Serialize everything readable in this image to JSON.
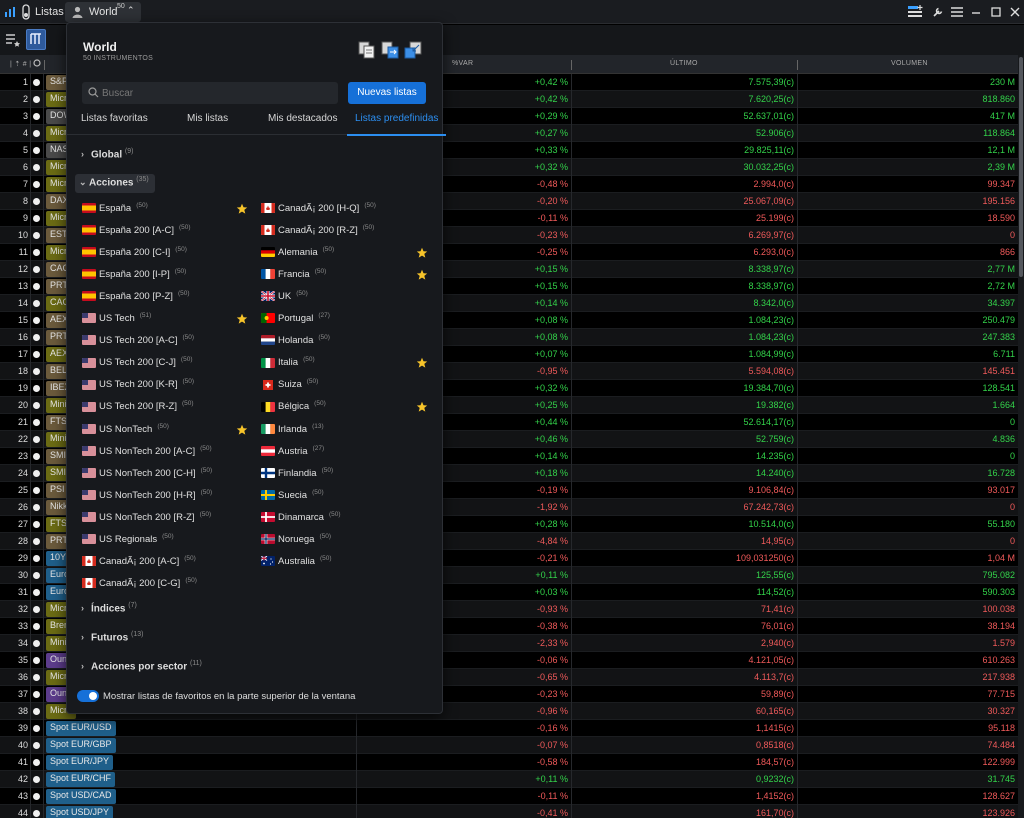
{
  "titlebar": {
    "app_label": "Listas",
    "watchlist_label": "World",
    "watchlist_count": "50"
  },
  "columns": {
    "var": "%VAR",
    "last": "ÚLTIMO",
    "volume": "VOLUMEN"
  },
  "rows": [
    {
      "n": "1",
      "sym": "S&P",
      "color": "#6b5a3c",
      "var": "+0,42 %",
      "last": "7.575,39(c)",
      "vol": "230 M",
      "dir": "pos"
    },
    {
      "n": "2",
      "sym": "Micro",
      "color": "#6b6b14",
      "var": "+0,42 %",
      "last": "7.620,25(c)",
      "vol": "818.860",
      "dir": "pos"
    },
    {
      "n": "3",
      "sym": "DOW",
      "color": "#4a4a4a",
      "var": "+0,29 %",
      "last": "52.637,01(c)",
      "vol": "417 M",
      "dir": "pos"
    },
    {
      "n": "4",
      "sym": "Micro",
      "color": "#6b6b14",
      "var": "+0,27 %",
      "last": "52.906(c)",
      "vol": "118.864",
      "dir": "pos"
    },
    {
      "n": "5",
      "sym": "NASDAQ",
      "color": "#4a4a4a",
      "var": "+0,33 %",
      "last": "29.825,11(c)",
      "vol": "12,1 M",
      "dir": "pos"
    },
    {
      "n": "6",
      "sym": "Micro",
      "color": "#6b6b14",
      "var": "+0,32 %",
      "last": "30.032,25(c)",
      "vol": "2,39 M",
      "dir": "pos"
    },
    {
      "n": "7",
      "sym": "Micro",
      "color": "#6b6b14",
      "var": "-0,48 %",
      "last": "2.994,0(c)",
      "vol": "99.347",
      "dir": "neg"
    },
    {
      "n": "8",
      "sym": "DAX",
      "color": "#6b5a3c",
      "var": "-0,20 %",
      "last": "25.067,09(c)",
      "vol": "195.156",
      "dir": "neg"
    },
    {
      "n": "9",
      "sym": "Micro",
      "color": "#6b6b14",
      "var": "-0,11 %",
      "last": "25.199(c)",
      "vol": "18.590",
      "dir": "neg"
    },
    {
      "n": "10",
      "sym": "ESTX",
      "color": "#6b5a3c",
      "var": "-0,23 %",
      "last": "6.269,97(c)",
      "vol": "0",
      "dir": "neg"
    },
    {
      "n": "11",
      "sym": "Micro",
      "color": "#6b6b14",
      "var": "-0,25 %",
      "last": "6.293,0(c)",
      "vol": "866",
      "dir": "neg"
    },
    {
      "n": "12",
      "sym": "CAC",
      "color": "#6b5a3c",
      "var": "+0,15 %",
      "last": "8.338,97(c)",
      "vol": "2,77 M",
      "dir": "pos"
    },
    {
      "n": "13",
      "sym": "PRT",
      "color": "#6b5a3c",
      "var": "+0,15 %",
      "last": "8.338,97(c)",
      "vol": "2,72 M",
      "dir": "pos"
    },
    {
      "n": "14",
      "sym": "CAC",
      "color": "#6b6b14",
      "var": "+0,14 %",
      "last": "8.342,0(c)",
      "vol": "34.397",
      "dir": "pos"
    },
    {
      "n": "15",
      "sym": "AEX",
      "color": "#6b5a3c",
      "var": "+0,08 %",
      "last": "1.084,23(c)",
      "vol": "250.479",
      "dir": "pos"
    },
    {
      "n": "16",
      "sym": "PRT",
      "color": "#6b5a3c",
      "var": "+0,08 %",
      "last": "1.084,23(c)",
      "vol": "247.383",
      "dir": "pos"
    },
    {
      "n": "17",
      "sym": "AEX",
      "color": "#6b6b14",
      "var": "+0,07 %",
      "last": "1.084,99(c)",
      "vol": "6.711",
      "dir": "pos"
    },
    {
      "n": "18",
      "sym": "BEL",
      "color": "#6b5a3c",
      "var": "-0,95 %",
      "last": "5.594,08(c)",
      "vol": "145.451",
      "dir": "neg"
    },
    {
      "n": "19",
      "sym": "IBEX",
      "color": "#6b5a3c",
      "var": "+0,32 %",
      "last": "19.384,70(c)",
      "vol": "128.541",
      "dir": "pos"
    },
    {
      "n": "20",
      "sym": "Mini",
      "color": "#6b6b14",
      "var": "+0,25 %",
      "last": "19.382(c)",
      "vol": "1.664",
      "dir": "pos"
    },
    {
      "n": "21",
      "sym": "FTSE",
      "color": "#6b5a3c",
      "var": "+0,44 %",
      "last": "52.614,17(c)",
      "vol": "0",
      "dir": "pos"
    },
    {
      "n": "22",
      "sym": "Mini",
      "color": "#6b6b14",
      "var": "+0,46 %",
      "last": "52.759(c)",
      "vol": "4.836",
      "dir": "pos"
    },
    {
      "n": "23",
      "sym": "SMI",
      "color": "#6b5a3c",
      "var": "+0,14 %",
      "last": "14.235(c)",
      "vol": "0",
      "dir": "pos"
    },
    {
      "n": "24",
      "sym": "SMI",
      "color": "#6b6b14",
      "var": "+0,18 %",
      "last": "14.240(c)",
      "vol": "16.728",
      "dir": "pos"
    },
    {
      "n": "25",
      "sym": "PSI",
      "color": "#6b5a3c",
      "var": "-0,19 %",
      "last": "9.106,84(c)",
      "vol": "93.017",
      "dir": "neg"
    },
    {
      "n": "26",
      "sym": "Nikkei",
      "color": "#6b5a3c",
      "var": "-1,92 %",
      "last": "67.242,73(c)",
      "vol": "0",
      "dir": "neg"
    },
    {
      "n": "27",
      "sym": "FTSE",
      "color": "#6b6b14",
      "var": "+0,28 %",
      "last": "10.514,0(c)",
      "vol": "55.180",
      "dir": "pos"
    },
    {
      "n": "28",
      "sym": "PRT",
      "color": "#6b5a3c",
      "var": "-4,84 %",
      "last": "14,95(c)",
      "vol": "0",
      "dir": "neg"
    },
    {
      "n": "29",
      "sym": "10Y",
      "color": "#1f5f8a",
      "var": "-0,21 %",
      "last": "109,031250(c)",
      "vol": "1,04 M",
      "dir": "neg"
    },
    {
      "n": "30",
      "sym": "Euro",
      "color": "#1f5f8a",
      "var": "+0,11 %",
      "last": "125,55(c)",
      "vol": "795.082",
      "dir": "pos"
    },
    {
      "n": "31",
      "sym": "Euro",
      "color": "#1f5f8a",
      "var": "+0,03 %",
      "last": "114,52(c)",
      "vol": "590.303",
      "dir": "pos"
    },
    {
      "n": "32",
      "sym": "Micro",
      "color": "#6b6b14",
      "var": "-0,93 %",
      "last": "71,41(c)",
      "vol": "100.038",
      "dir": "neg"
    },
    {
      "n": "33",
      "sym": "Brent",
      "color": "#6b6b14",
      "var": "-0,38 %",
      "last": "76,01(c)",
      "vol": "38.194",
      "dir": "neg"
    },
    {
      "n": "34",
      "sym": "Mini",
      "color": "#6b6b14",
      "var": "-2,33 %",
      "last": "2,940(c)",
      "vol": "1.579",
      "dir": "neg"
    },
    {
      "n": "35",
      "sym": "Ounce",
      "color": "#5c3c8c",
      "var": "-0,06 %",
      "last": "4.121,05(c)",
      "vol": "610.263",
      "dir": "neg"
    },
    {
      "n": "36",
      "sym": "Micro",
      "color": "#6b6b14",
      "var": "-0,65 %",
      "last": "4.113,7(c)",
      "vol": "217.938",
      "dir": "neg"
    },
    {
      "n": "37",
      "sym": "Ounce",
      "color": "#5c3c8c",
      "var": "-0,23 %",
      "last": "59,89(c)",
      "vol": "77.715",
      "dir": "neg"
    },
    {
      "n": "38",
      "sym": "Micro",
      "color": "#6b6b14",
      "var": "-0,96 %",
      "last": "60,165(c)",
      "vol": "30.327",
      "dir": "neg"
    },
    {
      "n": "39",
      "sym": "Spot EUR/USD",
      "color": "#1f5f8a",
      "var": "-0,16 %",
      "last": "1,1415(c)",
      "vol": "95.118",
      "dir": "neg"
    },
    {
      "n": "40",
      "sym": "Spot EUR/GBP",
      "color": "#1f5f8a",
      "var": "-0,07 %",
      "last": "0,8518(c)",
      "vol": "74.484",
      "dir": "neg"
    },
    {
      "n": "41",
      "sym": "Spot EUR/JPY",
      "color": "#1f5f8a",
      "var": "-0,58 %",
      "last": "184,57(c)",
      "vol": "122.999",
      "dir": "neg"
    },
    {
      "n": "42",
      "sym": "Spot EUR/CHF",
      "color": "#1f5f8a",
      "var": "+0,11 %",
      "last": "0,9232(c)",
      "vol": "31.745",
      "dir": "pos"
    },
    {
      "n": "43",
      "sym": "Spot USD/CAD",
      "color": "#1f5f8a",
      "var": "-0,11 %",
      "last": "1,4152(c)",
      "vol": "128.627",
      "dir": "neg"
    },
    {
      "n": "44",
      "sym": "Spot USD/JPY",
      "color": "#1f5f8a",
      "var": "-0,41 %",
      "last": "161,70(c)",
      "vol": "123.926",
      "dir": "neg"
    }
  ],
  "dropdown": {
    "title": "World",
    "subtitle": "50 INSTRUMENTOS",
    "search_placeholder": "Buscar",
    "new_list_label": "Nuevas listas",
    "tabs": [
      "Listas favoritas",
      "Mis listas",
      "Mis destacados",
      "Listas predefinidas"
    ],
    "categories": [
      {
        "label": "Global",
        "count": "(9)"
      },
      {
        "label": "Acciones",
        "count": "(35)"
      },
      {
        "label": "Índices",
        "count": "(7)"
      },
      {
        "label": "Futuros",
        "count": "(13)"
      },
      {
        "label": "Acciones por sector",
        "count": "(11)"
      }
    ],
    "left_lists": [
      {
        "label": "España",
        "count": "(50)",
        "flag": "es",
        "star": true
      },
      {
        "label": "España 200 [A-C]",
        "count": "(50)",
        "flag": "es",
        "star": false
      },
      {
        "label": "España 200 [C-I]",
        "count": "(50)",
        "flag": "es",
        "star": false
      },
      {
        "label": "España 200 [I-P]",
        "count": "(50)",
        "flag": "es",
        "star": false
      },
      {
        "label": "España 200 [P-Z]",
        "count": "(50)",
        "flag": "es",
        "star": false
      },
      {
        "label": "US Tech",
        "count": "(51)",
        "flag": "us",
        "star": true
      },
      {
        "label": "US Tech 200 [A-C]",
        "count": "(50)",
        "flag": "us",
        "star": false
      },
      {
        "label": "US Tech 200 [C-J]",
        "count": "(50)",
        "flag": "us",
        "star": false
      },
      {
        "label": "US Tech 200 [K-R]",
        "count": "(50)",
        "flag": "us",
        "star": false
      },
      {
        "label": "US Tech 200 [R-Z]",
        "count": "(50)",
        "flag": "us",
        "star": false
      },
      {
        "label": "US NonTech",
        "count": "(50)",
        "flag": "us",
        "star": true
      },
      {
        "label": "US NonTech 200 [A-C]",
        "count": "(50)",
        "flag": "us",
        "star": false
      },
      {
        "label": "US NonTech 200 [C-H]",
        "count": "(50)",
        "flag": "us",
        "star": false
      },
      {
        "label": "US NonTech 200 [H-R]",
        "count": "(50)",
        "flag": "us",
        "star": false
      },
      {
        "label": "US NonTech 200 [R-Z]",
        "count": "(50)",
        "flag": "us",
        "star": false
      },
      {
        "label": "US Regionals",
        "count": "(50)",
        "flag": "us",
        "star": false
      },
      {
        "label": "CanadÃ¡ 200 [A-C]",
        "count": "(50)",
        "flag": "ca",
        "star": false
      },
      {
        "label": "CanadÃ¡ 200 [C-G]",
        "count": "(50)",
        "flag": "ca",
        "star": false
      }
    ],
    "right_lists": [
      {
        "label": "CanadÃ¡ 200 [H-Q]",
        "count": "(50)",
        "flag": "ca",
        "star": false
      },
      {
        "label": "CanadÃ¡ 200 [R-Z]",
        "count": "(50)",
        "flag": "ca",
        "star": false
      },
      {
        "label": "Alemania",
        "count": "(50)",
        "flag": "de",
        "star": true
      },
      {
        "label": "Francia",
        "count": "(50)",
        "flag": "fr",
        "star": true
      },
      {
        "label": "UK",
        "count": "(50)",
        "flag": "uk",
        "star": false
      },
      {
        "label": "Portugal",
        "count": "(27)",
        "flag": "pt",
        "star": false
      },
      {
        "label": "Holanda",
        "count": "(50)",
        "flag": "nl",
        "star": false
      },
      {
        "label": "Italia",
        "count": "(50)",
        "flag": "it",
        "star": true
      },
      {
        "label": "Suiza",
        "count": "(50)",
        "flag": "ch",
        "star": false
      },
      {
        "label": "Bélgica",
        "count": "(50)",
        "flag": "be",
        "star": true
      },
      {
        "label": "Irlanda",
        "count": "(13)",
        "flag": "ie",
        "star": false
      },
      {
        "label": "Austria",
        "count": "(27)",
        "flag": "at",
        "star": false
      },
      {
        "label": "Finlandia",
        "count": "(50)",
        "flag": "fi",
        "star": false
      },
      {
        "label": "Suecia",
        "count": "(50)",
        "flag": "se",
        "star": false
      },
      {
        "label": "Dinamarca",
        "count": "(50)",
        "flag": "dk",
        "star": false
      },
      {
        "label": "Noruega",
        "count": "(50)",
        "flag": "no",
        "star": false
      },
      {
        "label": "Australia",
        "count": "(50)",
        "flag": "au",
        "star": false
      }
    ],
    "toggle_label": "Mostrar listas de favoritos en la parte superior de la ventana"
  }
}
